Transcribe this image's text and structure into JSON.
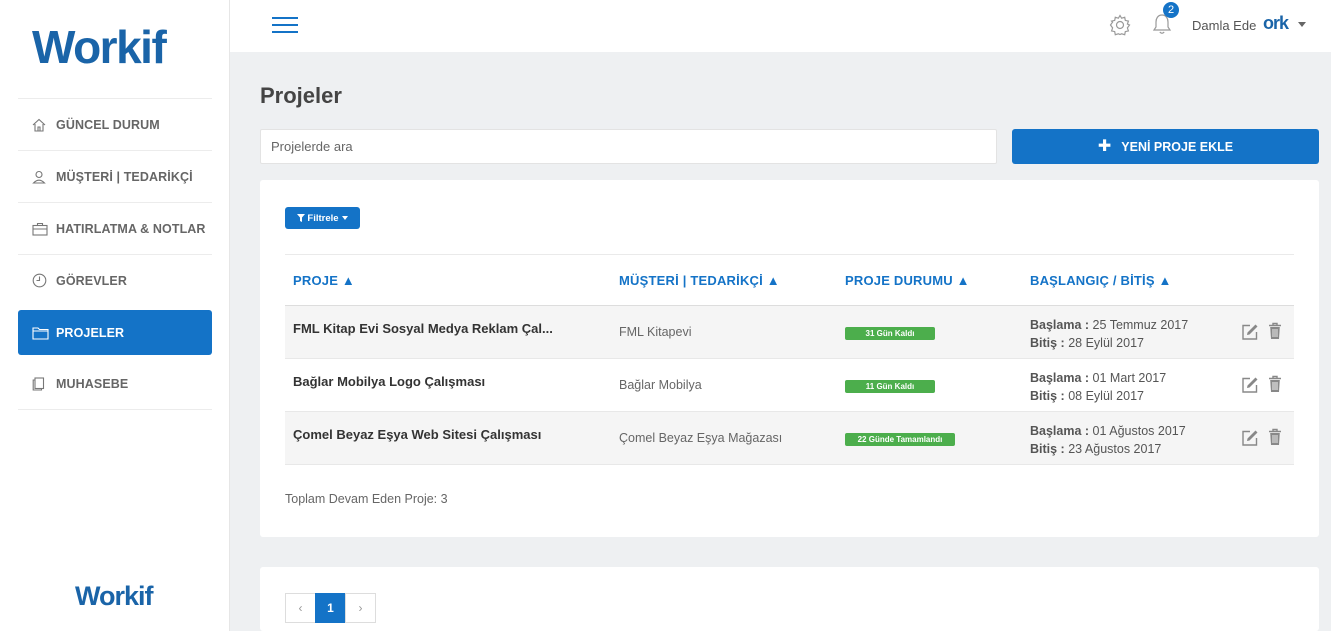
{
  "brand": {
    "logo_text": "Workif",
    "footer_logo_text": "Workif"
  },
  "sidebar": {
    "items": [
      {
        "label": "GÜNCEL DURUM",
        "icon": "home-icon"
      },
      {
        "label": "MÜŞTERİ | TEDARİKÇİ",
        "icon": "user-icon"
      },
      {
        "label": "HATIRLATMA & NOTLAR",
        "icon": "briefcase-icon"
      },
      {
        "label": "GÖREVLER",
        "icon": "clock-icon"
      },
      {
        "label": "PROJELER",
        "icon": "folder-icon",
        "active": true
      },
      {
        "label": "MUHASEBE",
        "icon": "document-icon"
      }
    ]
  },
  "topbar": {
    "notification_count": "2",
    "user_name": "Damla Ede",
    "user_avatar_text": "ork"
  },
  "page": {
    "title": "Projeler",
    "search_placeholder": "Projelerde ara",
    "add_button_label": "YENİ PROJE EKLE",
    "filter_label": "Filtrele"
  },
  "table": {
    "headers": {
      "project": "PROJE ▲",
      "client": "MÜŞTERİ | TEDARİKÇİ ▲",
      "status": "PROJE DURUMU ▲",
      "dates": "BAŞLANGIÇ / BİTİŞ ▲"
    },
    "start_label": "Başlama :",
    "end_label": "Bitiş :",
    "rows": [
      {
        "name": "FML Kitap Evi Sosyal Medya Reklam Çal...",
        "client": "FML Kitapevi",
        "status": "31 Gün Kaldı",
        "start": "25 Temmuz 2017",
        "end": "28 Eylül 2017"
      },
      {
        "name": "Bağlar Mobilya Logo Çalışması",
        "client": "Bağlar Mobilya",
        "status": "11 Gün Kaldı",
        "start": "01 Mart 2017",
        "end": "08 Eylül 2017"
      },
      {
        "name": "Çomel Beyaz Eşya Web Sitesi Çalışması",
        "client": "Çomel Beyaz Eşya Mağazası",
        "status": "22 Günde Tamamlandı",
        "start": "01 Ağustos 2017",
        "end": "23 Ağustos 2017"
      }
    ],
    "total_label": "Toplam Devam Eden Proje: 3"
  },
  "pagination": {
    "prev": "‹",
    "current": "1",
    "next": "›"
  },
  "colors": {
    "primary": "#1473c7",
    "success": "#4cae4c",
    "logo": "#1a64a8"
  }
}
